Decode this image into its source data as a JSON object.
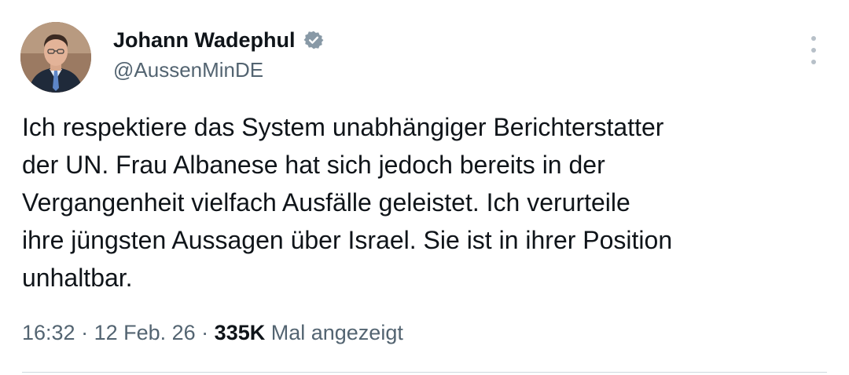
{
  "author": {
    "display_name": "Johann Wadephul",
    "handle": "@AussenMinDE",
    "verified_icon": "verified-badge-icon",
    "verified_color": "#8899a6"
  },
  "tweet": {
    "lines": [
      "Ich respektiere das System unabhängiger Berichterstatter",
      "der UN. Frau Albanese hat sich jedoch bereits in der",
      "Vergangenheit vielfach Ausfälle geleistet. Ich verurteile",
      "ihre jüngsten Aussagen über Israel. Sie ist in ihrer Position",
      "unhaltbar."
    ]
  },
  "meta": {
    "time": "16:32",
    "separator": " · ",
    "date": "12 Feb. 26",
    "views_count": "335K",
    "views_label": "Mal angezeigt"
  },
  "colors": {
    "text": "#0f1419",
    "secondary": "#536471",
    "divider": "#cfd9de"
  }
}
